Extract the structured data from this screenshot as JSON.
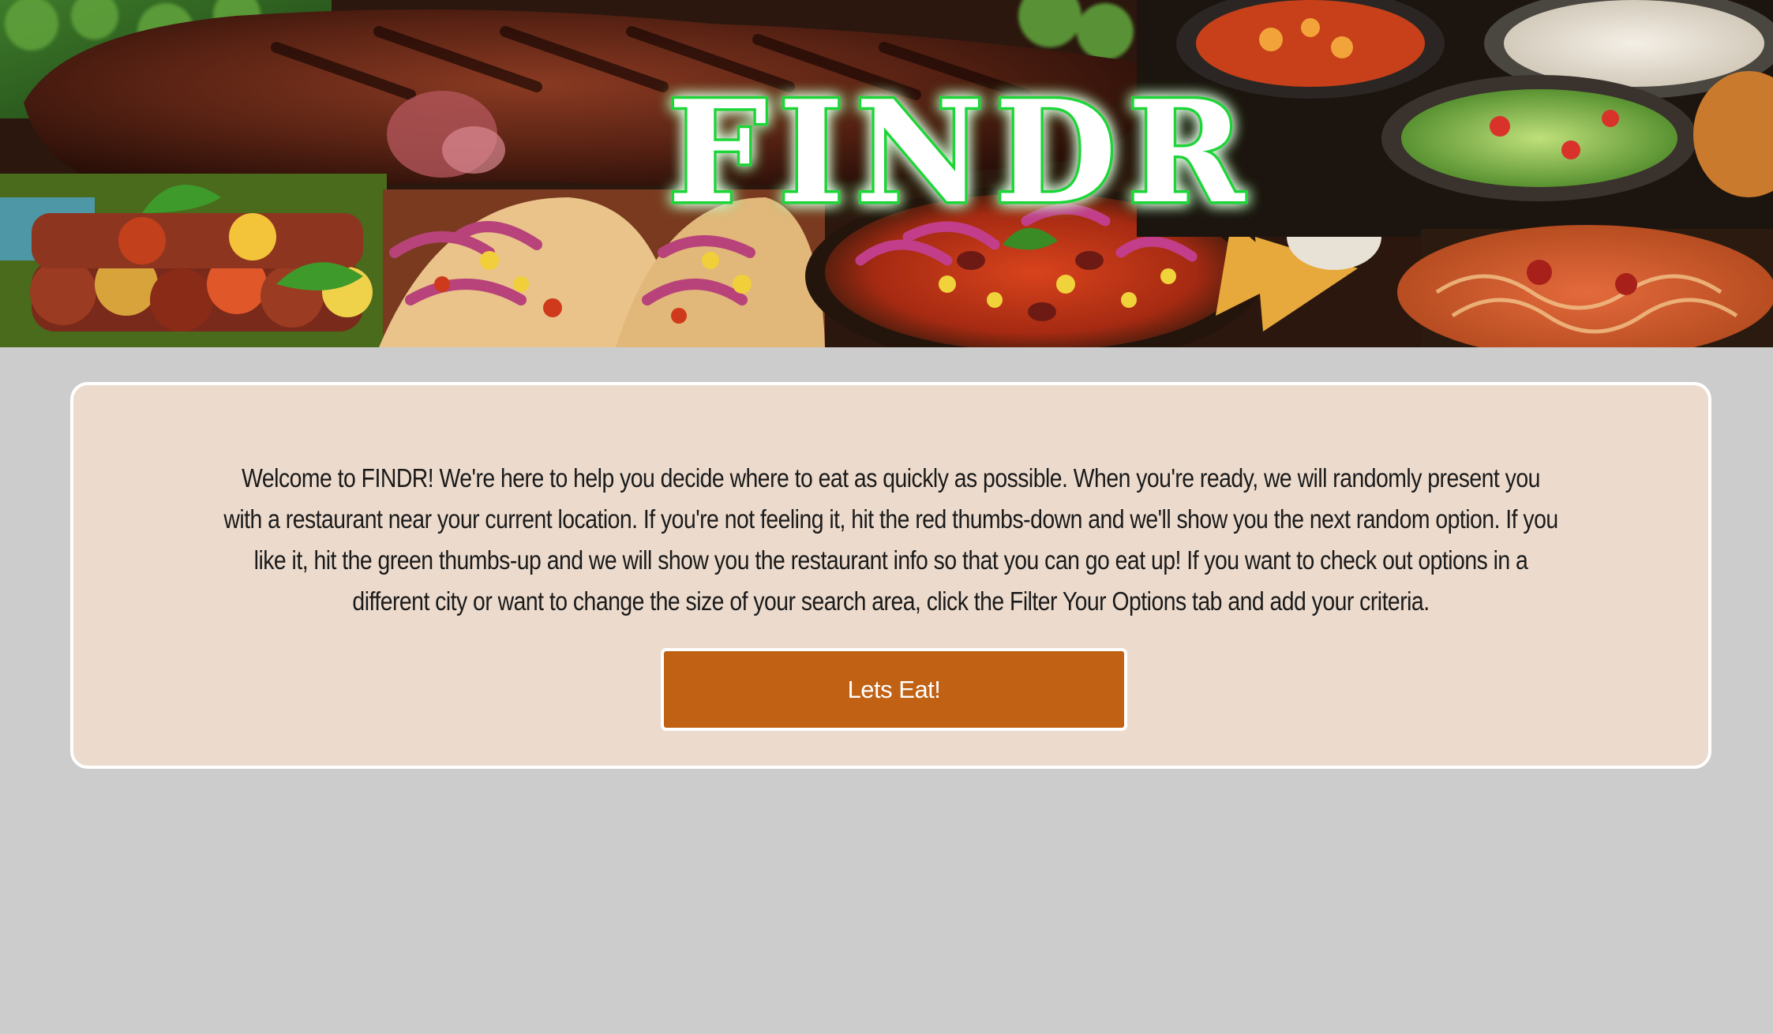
{
  "header": {
    "logo_text": "FINDR",
    "logo_glow_color": "#22e03a",
    "banner_description_icon": "food-collage-image"
  },
  "welcome": {
    "intro_text": "Welcome to FINDR! We're here to help you decide where to eat as quickly as possible. When you're ready, we will randomly present you with a restaurant near your current location. If you're not feeling it, hit the red thumbs-down and we'll show you the next random option. If you like it, hit the green thumbs-up and we will show you the restaurant info so that you can go eat up! If you want to check out options in a different city or want to change the size of your search area, click the Filter Your Options tab and add your criteria.",
    "cta_label": "Lets Eat!"
  },
  "colors": {
    "page_background": "#cccccc",
    "card_background": "#ecdbcd",
    "card_border": "#ffffff",
    "cta_background": "#c06114",
    "cta_text": "#ffffff"
  }
}
